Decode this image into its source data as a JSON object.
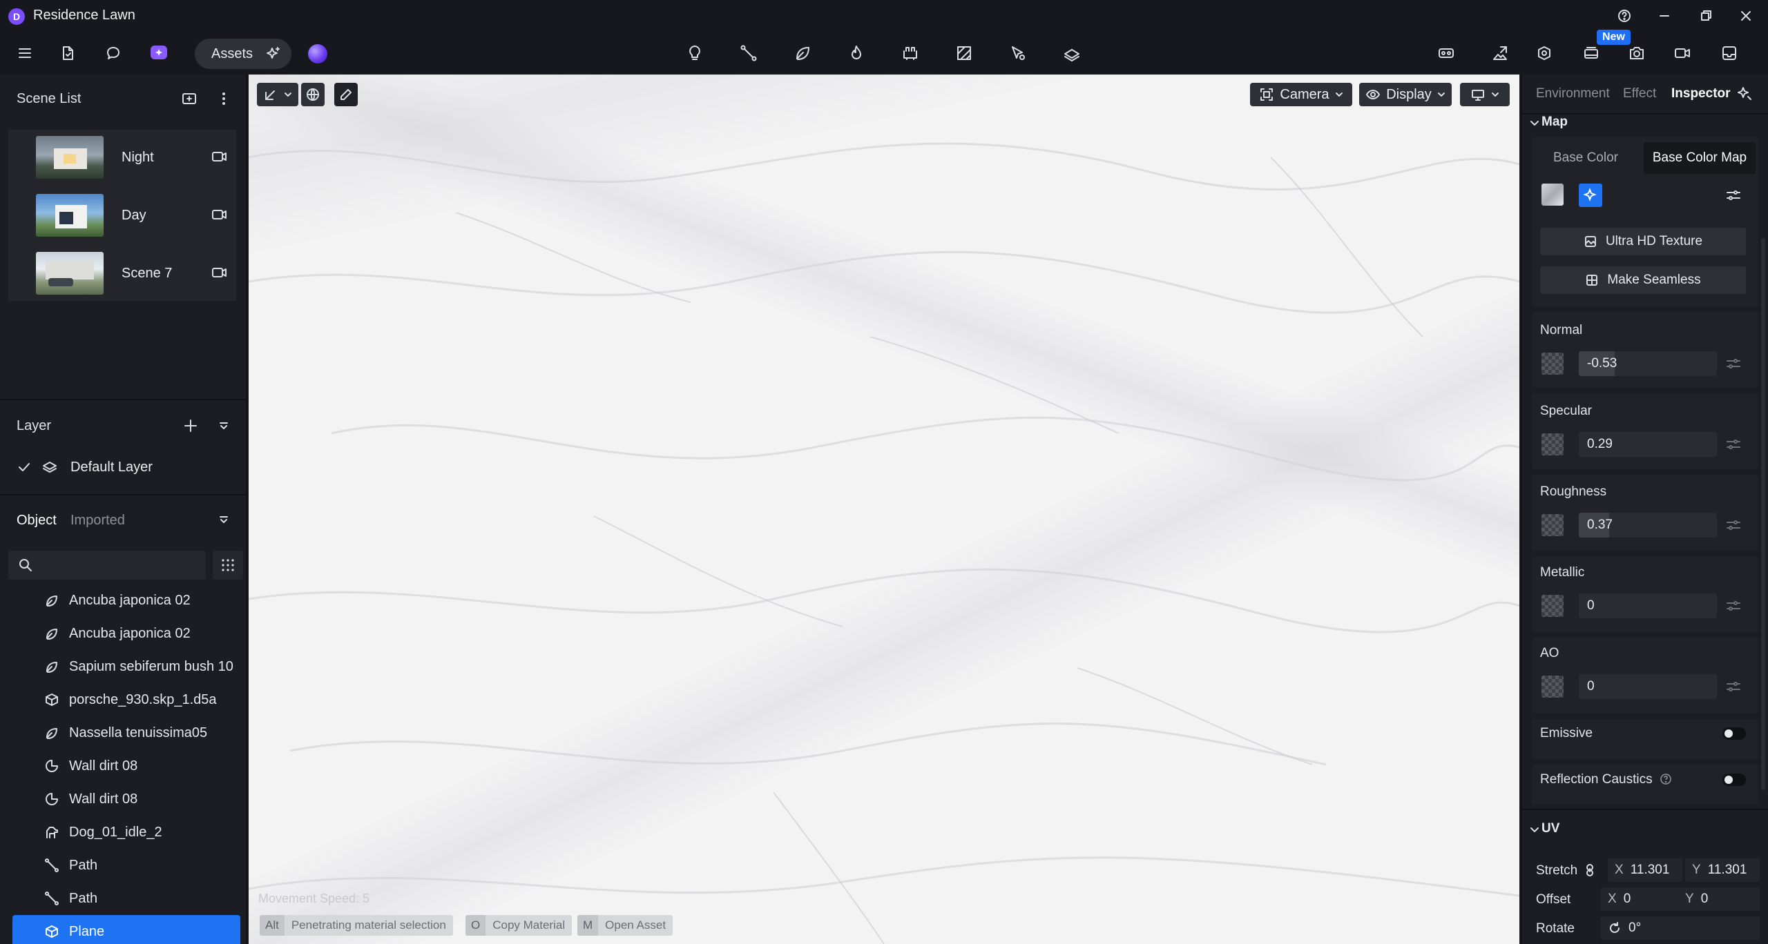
{
  "window": {
    "title": "Residence Lawn"
  },
  "toolbar": {
    "assets_label": "Assets",
    "new_badge": "New"
  },
  "scene_list": {
    "title": "Scene List",
    "scenes": [
      {
        "name": "Night"
      },
      {
        "name": "Day"
      },
      {
        "name": "Scene 7"
      }
    ]
  },
  "layer": {
    "title": "Layer",
    "items": [
      {
        "name": "Default Layer"
      }
    ]
  },
  "objects": {
    "tabs": [
      "Object",
      "Imported"
    ],
    "search": {
      "value": "",
      "placeholder": ""
    },
    "items": [
      {
        "name": "Ancuba japonica 02",
        "icon": "leaf-icon"
      },
      {
        "name": "Ancuba japonica 02",
        "icon": "leaf-icon"
      },
      {
        "name": "Sapium sebiferum bush 10",
        "icon": "leaf-icon"
      },
      {
        "name": "porsche_930.skp_1.d5a",
        "icon": "cube-icon"
      },
      {
        "name": "Nassella tenuissima05",
        "icon": "leaf-icon"
      },
      {
        "name": "Wall dirt 08",
        "icon": "decal-icon"
      },
      {
        "name": "Wall dirt 08",
        "icon": "decal-icon"
      },
      {
        "name": "Dog_01_idle_2",
        "icon": "dog-icon"
      },
      {
        "name": "Path",
        "icon": "path-icon"
      },
      {
        "name": "Path",
        "icon": "path-icon"
      },
      {
        "name": "Plane",
        "icon": "cube-icon",
        "selected": true
      }
    ]
  },
  "viewport": {
    "camera_label": "Camera",
    "display_label": "Display",
    "movement_speed": "Movement Speed: 5",
    "hints": [
      {
        "key": "Alt",
        "label": "Penetrating material selection"
      },
      {
        "key": "O",
        "label": "Copy Material"
      },
      {
        "key": "M",
        "label": "Open Asset"
      }
    ]
  },
  "inspector": {
    "tabs": [
      "Environment",
      "Effect",
      "Inspector"
    ],
    "active_tab": "Inspector",
    "map_section": "Map",
    "base_tabs": [
      "Base Color",
      "Base Color Map"
    ],
    "ultra_hd": "Ultra HD Texture",
    "make_seamless": "Make Seamless",
    "normal": {
      "label": "Normal",
      "value": "-0.53",
      "fill": 0.26
    },
    "specular": {
      "label": "Specular",
      "value": "0.29",
      "fill": 0.0
    },
    "roughness": {
      "label": "Roughness",
      "value": "0.37",
      "fill": 0.22
    },
    "metallic": {
      "label": "Metallic",
      "value": "0",
      "fill": 0.0
    },
    "ao": {
      "label": "AO",
      "value": "0",
      "fill": 0.0
    },
    "emissive": {
      "label": "Emissive",
      "on": false
    },
    "reflection_caustics": {
      "label": "Reflection Caustics",
      "on": false
    },
    "uv": {
      "title": "UV",
      "stretch_label": "Stretch",
      "stretch_x": "11.301",
      "stretch_y": "11.301",
      "offset_label": "Offset",
      "offset_x": "0",
      "offset_y": "0",
      "rotate_label": "Rotate",
      "rotate_value": "0°",
      "x_axis": "X",
      "y_axis": "Y"
    }
  },
  "colors": {
    "accent": "#1d73f2",
    "panel": "#1b1d22",
    "background": "#16181d"
  }
}
